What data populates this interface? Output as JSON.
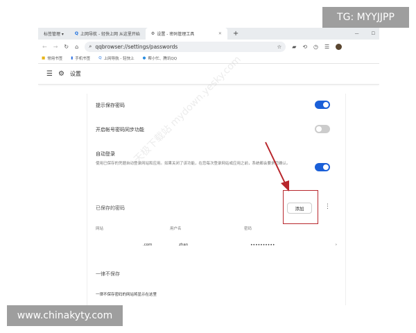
{
  "browser": {
    "tabs": [
      {
        "label": "标签管理 ▾"
      },
      {
        "label": "上网导航 - 轻快上网 从这里开始"
      },
      {
        "label": "设置 - 密码管理工具"
      }
    ],
    "new_tab": "+",
    "url": "qqbrowser://settings/passwords",
    "bookmarks": [
      "常用书签",
      "手机书签",
      "上网导航 - 轻快上",
      "帮小忙、腾讯QQ"
    ]
  },
  "header": {
    "title": "设置"
  },
  "settings": {
    "offer_save": {
      "label": "提示保存密码",
      "enabled": true
    },
    "sync": {
      "label": "开启帐号密码同步功能",
      "enabled": false
    },
    "auto_login": {
      "label": "自动登录",
      "description": "使用已保存的凭据自动登录网站和应用。如果关闭了该功能，在您每次登录网站或应用之前，系统都会要求您确认。",
      "enabled": true
    }
  },
  "saved": {
    "title": "已保存的密码",
    "add_label": "添加",
    "columns": [
      "网站",
      "用户名",
      "密码"
    ],
    "rows": [
      {
        "site": ".com",
        "user": "zhan",
        "password": "••••••••••"
      }
    ]
  },
  "never": {
    "title": "一律不保存",
    "empty": "一律不保存密码的网站将显示在这里"
  },
  "watermarks": {
    "tg": "TG: MYYJJPP",
    "site": "www.chinakyty.com",
    "diagonal": "天极下载站 mydown.yesky.com"
  },
  "colors": {
    "toggle_on": "#1a5fd8",
    "highlight": "#b8262c"
  }
}
